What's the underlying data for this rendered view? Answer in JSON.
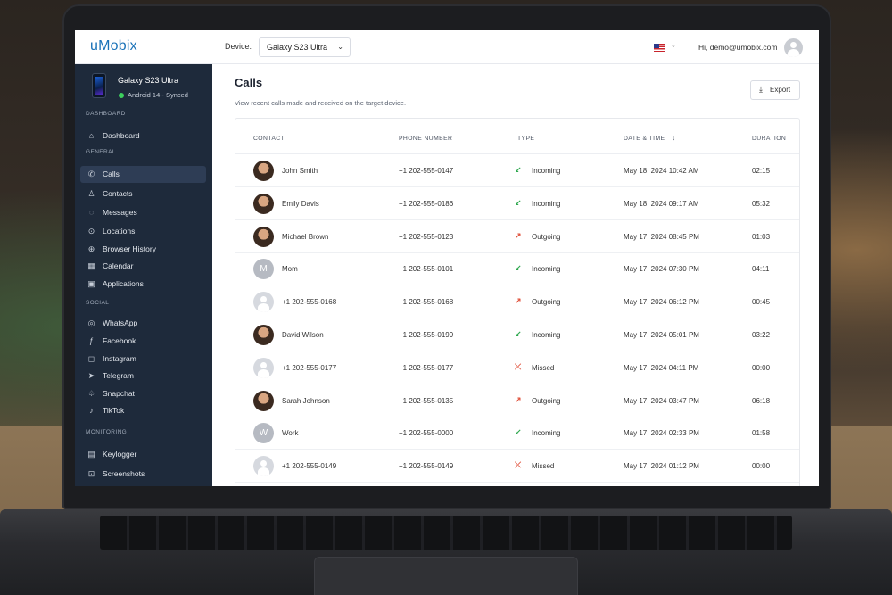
{
  "app": {
    "logo": "uMobix",
    "device_label": "Device:",
    "device_selected": "Galaxy S23 Ultra",
    "greeting": "Hi, demo@umobix.com"
  },
  "device_card": {
    "name": "Galaxy S23 Ultra",
    "status": "Android 14 - Synced",
    "status_color": "#3ccf5d"
  },
  "sidebar": {
    "sections": [
      "DASHBOARD",
      "GENERAL",
      "SOCIAL",
      "MONITORING"
    ],
    "items": [
      {
        "label": "Dashboard",
        "icon": "home-icon"
      },
      {
        "label": "Calls",
        "icon": "phone-icon",
        "active": true
      },
      {
        "label": "Contacts",
        "icon": "user-icon"
      },
      {
        "label": "Messages",
        "icon": "chat-icon"
      },
      {
        "label": "Locations",
        "icon": "location-icon"
      },
      {
        "label": "Browser History",
        "icon": "globe-icon"
      },
      {
        "label": "Calendar",
        "icon": "calendar-icon"
      },
      {
        "label": "Applications",
        "icon": "apps-icon"
      },
      {
        "label": "WhatsApp",
        "icon": "whatsapp-icon"
      },
      {
        "label": "Facebook",
        "icon": "facebook-icon"
      },
      {
        "label": "Instagram",
        "icon": "instagram-icon"
      },
      {
        "label": "Telegram",
        "icon": "telegram-icon"
      },
      {
        "label": "Snapchat",
        "icon": "snapchat-icon"
      },
      {
        "label": "TikTok",
        "icon": "tiktok-icon"
      },
      {
        "label": "Keylogger",
        "icon": "keyboard-icon"
      },
      {
        "label": "Screenshots",
        "icon": "screenshot-icon"
      }
    ]
  },
  "page": {
    "title": "Calls",
    "subtitle": "View recent calls made and received on the target device.",
    "export_label": "Export"
  },
  "table": {
    "headers": {
      "contact": "CONTACT",
      "phone": "PHONE NUMBER",
      "type": "TYPE",
      "date": "DATE & TIME",
      "duration": "DURATION"
    },
    "sort_indicator": "↓",
    "type_colors": {
      "Incoming": "#2fa84f",
      "Outgoing": "#e0503a",
      "Missed": "#e0503a"
    },
    "rows": [
      {
        "contact": "John Smith",
        "avatar": "photo",
        "phone": "+1 202-555-0147",
        "type": "Incoming",
        "date": "May 18, 2024  10:42 AM",
        "duration": "02:15"
      },
      {
        "contact": "Emily Davis",
        "avatar": "photo",
        "phone": "+1 202-555-0186",
        "type": "Incoming",
        "date": "May 18, 2024  09:17 AM",
        "duration": "05:32"
      },
      {
        "contact": "Michael Brown",
        "avatar": "photo",
        "phone": "+1 202-555-0123",
        "type": "Outgoing",
        "date": "May 17, 2024  08:45 PM",
        "duration": "01:03"
      },
      {
        "contact": "Mom",
        "avatar": "letter",
        "initial": "M",
        "phone": "+1 202-555-0101",
        "type": "Incoming",
        "date": "May 17, 2024  07:30 PM",
        "duration": "04:11"
      },
      {
        "contact": "+1 202-555-0168",
        "avatar": "blank",
        "phone": "+1 202-555-0168",
        "type": "Outgoing",
        "date": "May 17, 2024  06:12 PM",
        "duration": "00:45"
      },
      {
        "contact": "David Wilson",
        "avatar": "photo",
        "phone": "+1 202-555-0199",
        "type": "Incoming",
        "date": "May 17, 2024  05:01 PM",
        "duration": "03:22"
      },
      {
        "contact": "+1 202-555-0177",
        "avatar": "blank",
        "phone": "+1 202-555-0177",
        "type": "Missed",
        "date": "May 17, 2024  04:11 PM",
        "duration": "00:00"
      },
      {
        "contact": "Sarah Johnson",
        "avatar": "photo",
        "phone": "+1 202-555-0135",
        "type": "Outgoing",
        "date": "May 17, 2024  03:47 PM",
        "duration": "06:18"
      },
      {
        "contact": "Work",
        "avatar": "letter",
        "initial": "W",
        "phone": "+1 202-555-0000",
        "type": "Incoming",
        "date": "May 17, 2024  02:33 PM",
        "duration": "01:58"
      },
      {
        "contact": "+1 202-555-0149",
        "avatar": "blank",
        "phone": "+1 202-555-0149",
        "type": "Missed",
        "date": "May 17, 2024  01:12 PM",
        "duration": "00:00"
      }
    ]
  }
}
